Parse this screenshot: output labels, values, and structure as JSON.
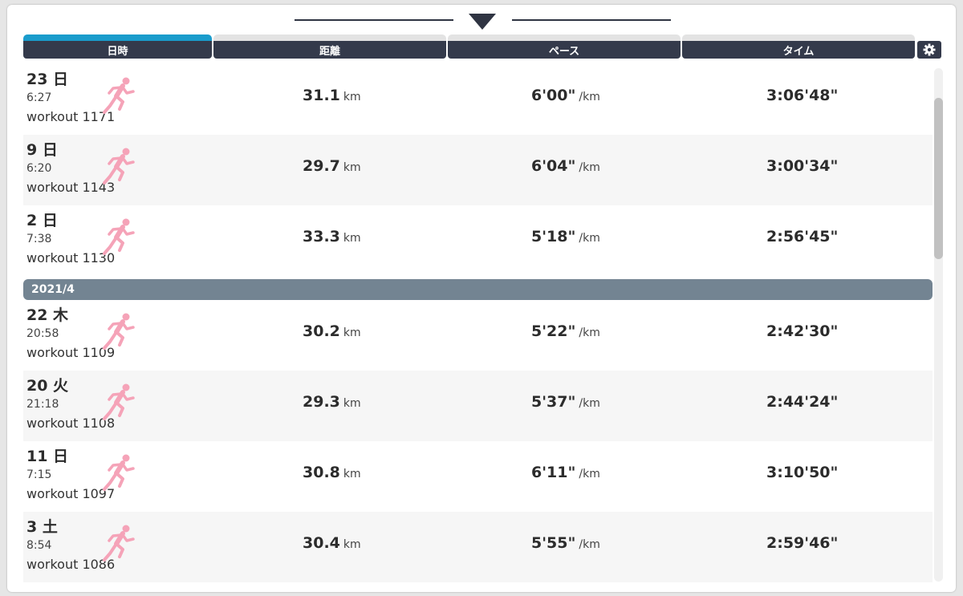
{
  "header": {
    "columns": [
      {
        "label": "日時",
        "active": true
      },
      {
        "label": "距離",
        "active": false
      },
      {
        "label": "ペース",
        "active": false
      },
      {
        "label": "タイム",
        "active": false
      }
    ]
  },
  "colors": {
    "header_bg": "#343a4b",
    "active_tab": "#1a9ccc",
    "month_bar": "#738492",
    "runner_icon": "#f5a3b8"
  },
  "rows": [
    {
      "day": "23 日",
      "time": "6:27",
      "name": "workout 1171",
      "distance": "31.1",
      "distance_unit": "km",
      "pace": "6'00\"",
      "pace_unit": "/km",
      "duration": "3:06'48\""
    },
    {
      "day": "9 日",
      "time": "6:20",
      "name": "workout 1143",
      "distance": "29.7",
      "distance_unit": "km",
      "pace": "6'04\"",
      "pace_unit": "/km",
      "duration": "3:00'34\""
    },
    {
      "day": "2 日",
      "time": "7:38",
      "name": "workout 1130",
      "distance": "33.3",
      "distance_unit": "km",
      "pace": "5'18\"",
      "pace_unit": "/km",
      "duration": "2:56'45\""
    }
  ],
  "month_group": {
    "label": "2021/4"
  },
  "rows2": [
    {
      "day": "22 木",
      "time": "20:58",
      "name": "workout 1109",
      "distance": "30.2",
      "distance_unit": "km",
      "pace": "5'22\"",
      "pace_unit": "/km",
      "duration": "2:42'30\""
    },
    {
      "day": "20 火",
      "time": "21:18",
      "name": "workout 1108",
      "distance": "29.3",
      "distance_unit": "km",
      "pace": "5'37\"",
      "pace_unit": "/km",
      "duration": "2:44'24\""
    },
    {
      "day": "11 日",
      "time": "7:15",
      "name": "workout 1097",
      "distance": "30.8",
      "distance_unit": "km",
      "pace": "6'11\"",
      "pace_unit": "/km",
      "duration": "3:10'50\""
    },
    {
      "day": "3 土",
      "time": "8:54",
      "name": "workout 1086",
      "distance": "30.4",
      "distance_unit": "km",
      "pace": "5'55\"",
      "pace_unit": "/km",
      "duration": "2:59'46\""
    }
  ],
  "icons": {
    "collapse": "chevron-down-icon",
    "settings": "gear-icon",
    "activity": "running-icon"
  }
}
